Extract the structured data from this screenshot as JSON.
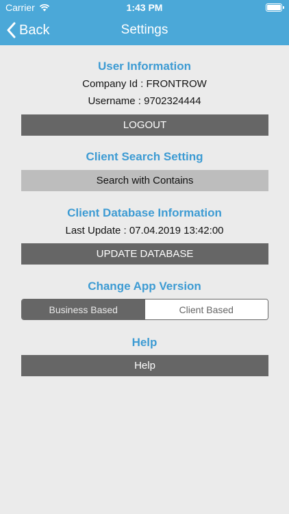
{
  "status_bar": {
    "carrier": "Carrier",
    "time": "1:43 PM"
  },
  "nav": {
    "back_label": "Back",
    "title": "Settings"
  },
  "user_info": {
    "heading": "User Information",
    "company_id": "Company Id : FRONTROW",
    "username": "Username : 9702324444",
    "logout_label": "LOGOUT"
  },
  "client_search": {
    "heading": "Client Search Setting",
    "option_label": "Search with Contains"
  },
  "client_db": {
    "heading": "Client Database Information",
    "last_update": "Last Update : 07.04.2019 13:42:00",
    "update_label": "UPDATE DATABASE"
  },
  "app_version": {
    "heading": "Change App Version",
    "segments": [
      {
        "label": "Business Based",
        "selected": true
      },
      {
        "label": "Client Based",
        "selected": false
      }
    ]
  },
  "help": {
    "heading": "Help",
    "button_label": "Help"
  },
  "colors": {
    "accent": "#4ba8d8",
    "heading": "#3d9bd3",
    "button": "#666666",
    "background": "#ebebeb"
  }
}
